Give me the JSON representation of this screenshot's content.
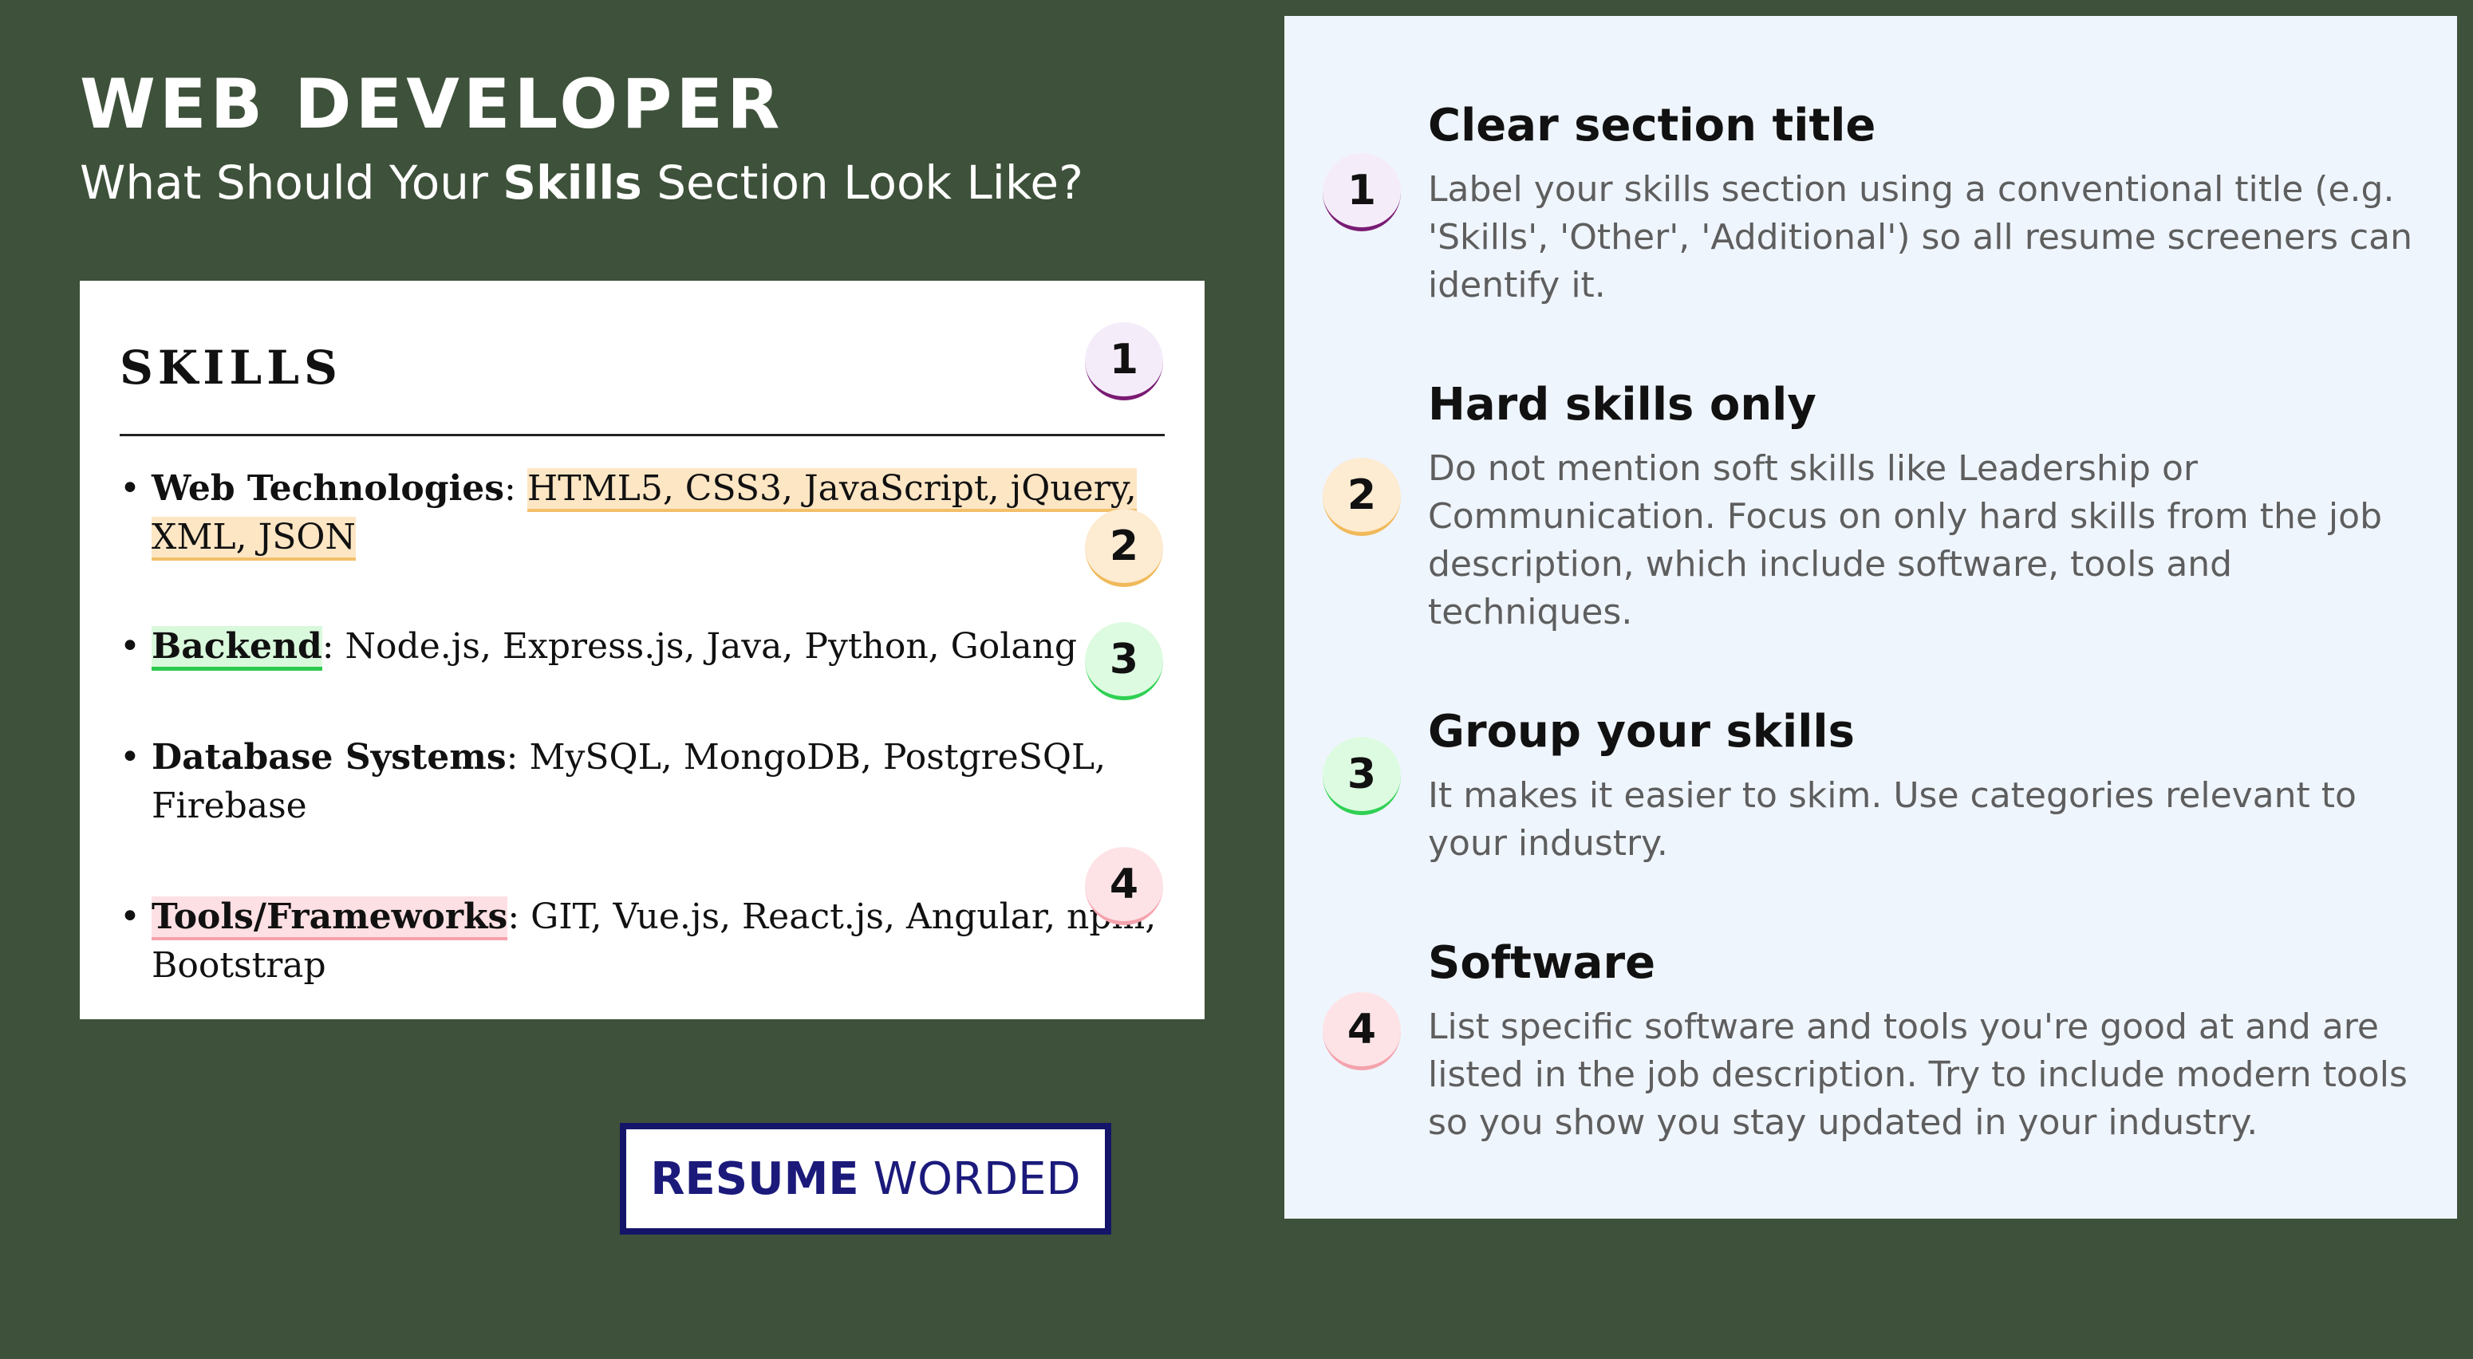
{
  "header": {
    "title": "WEB DEVELOPER",
    "subtitle_before": "What Should Your ",
    "subtitle_bold": "Skills",
    "subtitle_after": " Section Look Like?"
  },
  "resume": {
    "heading": "SKILLS",
    "items": [
      {
        "category": "Web Technologies",
        "separator": ": ",
        "values": "HTML5, CSS3, JavaScript, jQuery, XML, JSON"
      },
      {
        "category": "Backend",
        "separator": ": ",
        "values": "Node.js, Express.js, Java, Python, Golang"
      },
      {
        "category": "Database Systems",
        "separator": ": ",
        "values": "MySQL, MongoDB, PostgreSQL, Firebase"
      },
      {
        "category": "Tools/Frameworks",
        "separator": ": ",
        "values": "GIT, Vue.js, React.js, Angular, npm, Bootstrap"
      }
    ],
    "badges": [
      "1",
      "2",
      "3",
      "4"
    ]
  },
  "tips": [
    {
      "number": "1",
      "title": "Clear section title",
      "text": "Label your skills section using a conventional title (e.g. 'Skills', 'Other', 'Additional') so all resume screeners can identify it."
    },
    {
      "number": "2",
      "title": "Hard skills only",
      "text": "Do not mention soft skills like Leadership or Communication. Focus on only hard skills from the job description, which include software, tools and techniques."
    },
    {
      "number": "3",
      "title": "Group your skills",
      "text": "It makes it easier to skim. Use categories relevant to your industry."
    },
    {
      "number": "4",
      "title": "Software",
      "text": "List specific software and tools you're good at and are listed in the job description. Try to include modern tools so you show you stay updated in your industry."
    }
  ],
  "logo": {
    "bold": "RESUME",
    "regular": "WORDED"
  },
  "colors": {
    "background": "#3e513a",
    "panel": "#eff5fd",
    "badge1": "#7a1b73",
    "badge2": "#f1b95a",
    "badge3": "#2fd053",
    "badge4": "#f4a3ad",
    "logo": "#1b1a7b"
  }
}
